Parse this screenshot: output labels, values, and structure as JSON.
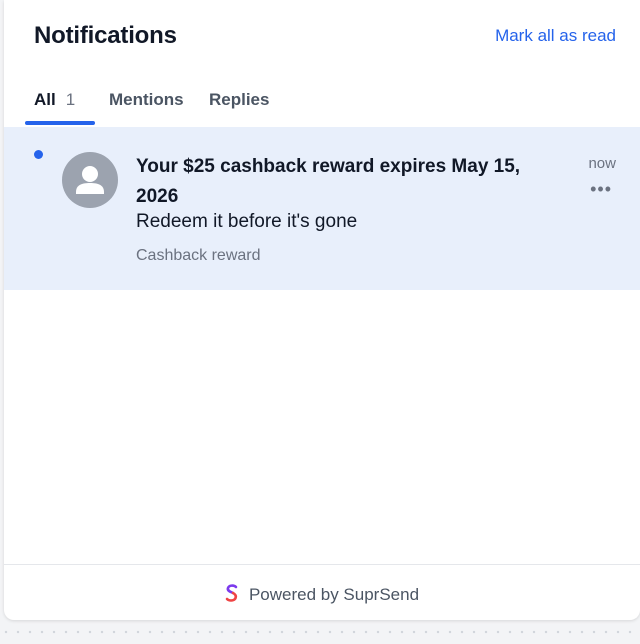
{
  "header": {
    "title": "Notifications",
    "mark_all_read": "Mark all as read"
  },
  "tabs": [
    {
      "label": "All",
      "count": "1",
      "active": true
    },
    {
      "label": "Mentions",
      "active": false
    },
    {
      "label": "Replies",
      "active": false
    }
  ],
  "notification": {
    "title": "Your $25 cashback reward expires May 15, 2026",
    "body": "Redeem it before it's gone",
    "subtext": "Cashback reward",
    "time": "now",
    "more": "•••",
    "unread": true
  },
  "footer": {
    "powered_by": "Powered by SuprSend"
  },
  "colors": {
    "accent": "#2563eb",
    "unread_bg": "#e8effb",
    "avatar": "#9ca3af"
  },
  "icons": {
    "avatar": "user-avatar-icon",
    "logo": "suprsend-logo-icon",
    "more": "more-options-icon"
  }
}
